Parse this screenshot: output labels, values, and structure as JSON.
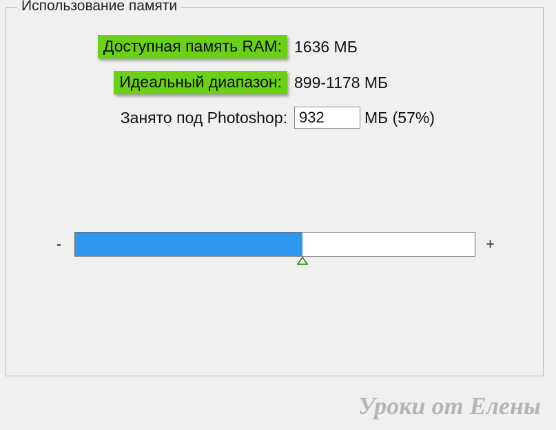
{
  "group": {
    "title": "Использование памяти"
  },
  "rows": {
    "available": {
      "label": "Доступная память RAM:",
      "value": "1636 МБ"
    },
    "ideal": {
      "label": "Идеальный диапазон:",
      "value": "899-1178 МБ"
    },
    "used": {
      "label": "Занято под Photoshop:",
      "input_value": "932",
      "suffix": "МБ (57%)"
    }
  },
  "slider": {
    "minus": "-",
    "plus": "+",
    "percent": 57
  },
  "watermark": "Уроки от Елены"
}
